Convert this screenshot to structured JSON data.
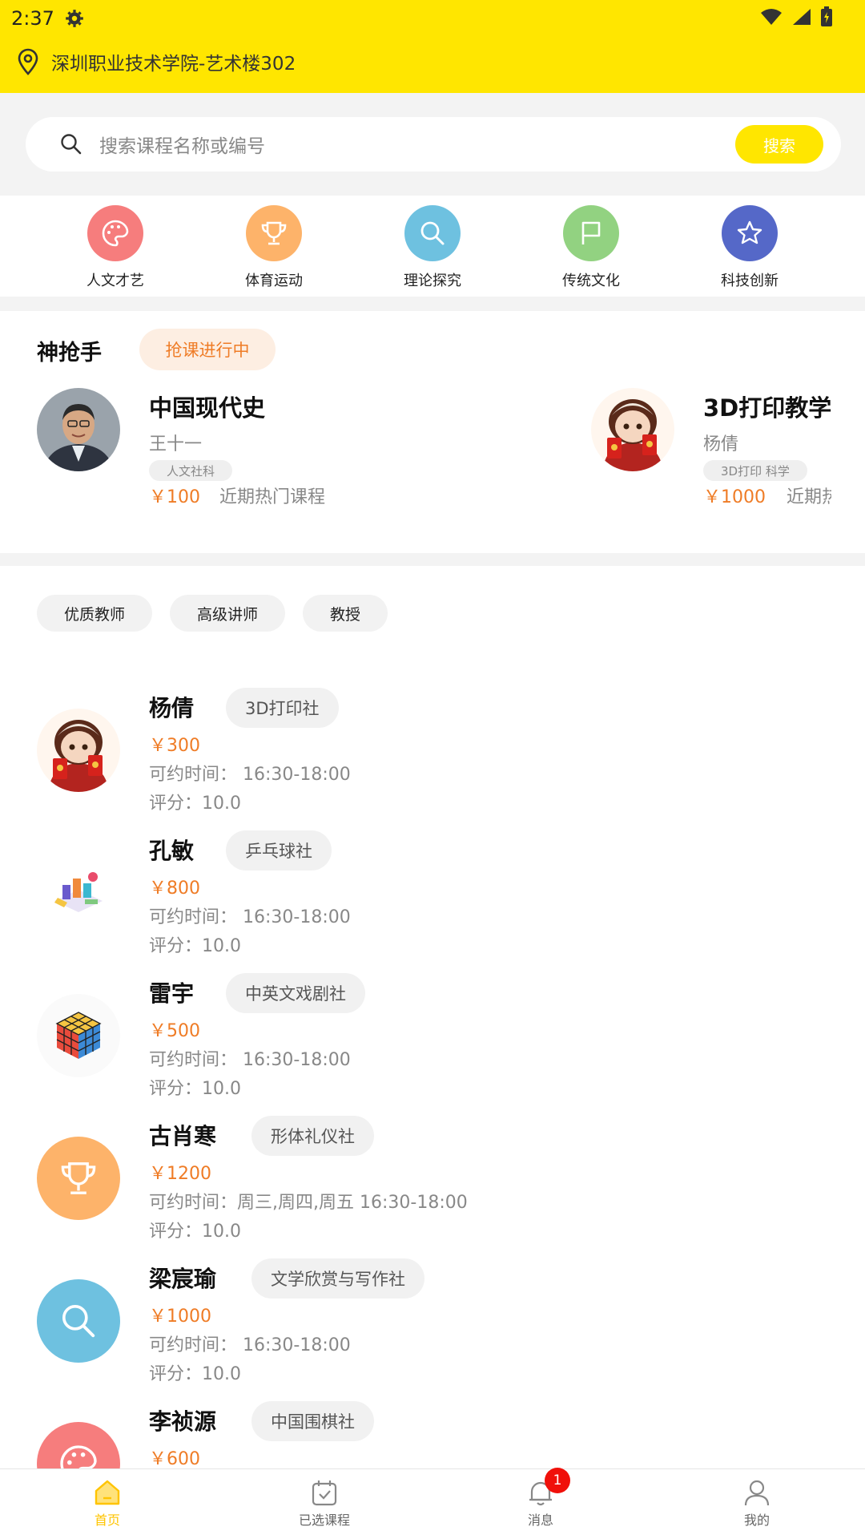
{
  "status_bar": {
    "time": "2:37"
  },
  "location": {
    "text": "深圳职业技术学院-艺术楼302"
  },
  "search": {
    "placeholder": "搜索课程名称或编号",
    "button": "搜索"
  },
  "categories": [
    {
      "label": "人文才艺",
      "icon": "palette-icon",
      "color": "#F67D7D"
    },
    {
      "label": "体育运动",
      "icon": "trophy-icon",
      "color": "#FDB36A"
    },
    {
      "label": "理论探究",
      "icon": "search-icon",
      "color": "#6EC1E0"
    },
    {
      "label": "传统文化",
      "icon": "flag-icon",
      "color": "#92D281"
    },
    {
      "label": "科技创新",
      "icon": "star-icon",
      "color": "#5568C8"
    }
  ],
  "rush": {
    "title": "神抢手",
    "badge": "抢课进行中",
    "courses": [
      {
        "name": "中国现代史",
        "teacher": "王十一",
        "tag": "人文社科",
        "price": "￥100",
        "note": "近期热门课程",
        "avatar": "man-photo"
      },
      {
        "name": "3D打印教学",
        "teacher": "杨倩",
        "tag": "3D打印 科学",
        "price": "￥1000",
        "note": "近期热门课程",
        "avatar": "cartoon-girl"
      }
    ]
  },
  "filters": [
    "优质教师",
    "高级讲师",
    "教授"
  ],
  "teachers": [
    {
      "name": "杨倩",
      "club": "3D打印社",
      "price": "￥300",
      "time": "可约时间： 16:30-18:00",
      "score": "评分：10.0",
      "avatar": "cartoon-girl"
    },
    {
      "name": "孔敏",
      "club": "乒乓球社",
      "price": "￥800",
      "time": "可约时间： 16:30-18:00",
      "score": "评分：10.0",
      "avatar": "isometric-art"
    },
    {
      "name": "雷宇",
      "club": "中英文戏剧社",
      "price": "￥500",
      "time": "可约时间： 16:30-18:00",
      "score": "评分：10.0",
      "avatar": "rubik-cube"
    },
    {
      "name": "古肖寒",
      "club": "形体礼仪社",
      "price": "￥1200",
      "time": "可约时间：周三,周四,周五 16:30-18:00",
      "score": "评分：10.0",
      "avatar": "trophy-icon"
    },
    {
      "name": "梁宸瑜",
      "club": "文学欣赏与写作社",
      "price": "￥1000",
      "time": "可约时间： 16:30-18:00",
      "score": "评分：10.0",
      "avatar": "search-icon"
    },
    {
      "name": "李祯源",
      "club": "中国围棋社",
      "price": "￥600",
      "time": "",
      "score": "",
      "avatar": "palette-icon"
    }
  ],
  "nav": [
    {
      "label": "首页",
      "icon": "home-icon",
      "active": true
    },
    {
      "label": "已选课程",
      "icon": "calendar-check-icon",
      "active": false
    },
    {
      "label": "消息",
      "icon": "bell-icon",
      "active": false,
      "badge": "1"
    },
    {
      "label": "我的",
      "icon": "user-icon",
      "active": false
    }
  ],
  "colors": {
    "brand": "#FFE600",
    "accent": "#EF7C26"
  }
}
